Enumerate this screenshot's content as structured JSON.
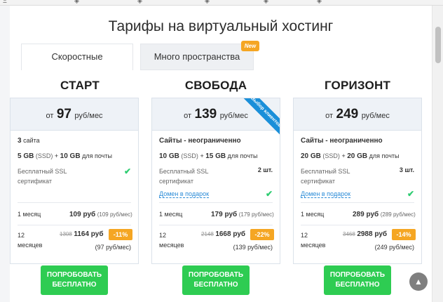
{
  "page": {
    "title": "Тарифы на виртуальный хостинг",
    "tabs": [
      {
        "label": "Скоростные"
      },
      {
        "label": "Много пространства"
      }
    ],
    "new_badge": "New",
    "ribbon": "Выбор клиентов",
    "button_line1": "ПОПРОБОВАТЬ",
    "button_line2": "БЕСПЛАТНО"
  },
  "plans": [
    {
      "name": "СТАРТ",
      "price_prefix": "от",
      "price": "97",
      "price_unit": "руб/мес",
      "sites": "3",
      "sites_label": "сайта",
      "disk": "5 GB",
      "disk_type": "(SSD)",
      "plus": "+",
      "mail": "10 GB",
      "mail_label": "для почты",
      "ssl_label": "Бесплатный SSL сертификат",
      "month_label": "1 месяц",
      "month_price": "109 руб",
      "month_per": "(109 руб/мес)",
      "year_label": "12 месяцев",
      "year_old": "1308",
      "year_price": "1164 руб",
      "year_discount": "-11%",
      "year_per": "(97 руб/мес)"
    },
    {
      "name": "СВОБОДА",
      "price_prefix": "от",
      "price": "139",
      "price_unit": "руб/мес",
      "sites": "Сайты - неограниченно",
      "disk": "10 GB",
      "disk_type": "(SSD)",
      "plus": "+",
      "mail": "15 GB",
      "mail_label": "для почты",
      "ssl_label": "Бесплатный SSL сертификат",
      "ssl_count": "2 шт.",
      "domain_label": "Домен в подарок",
      "month_label": "1 месяц",
      "month_price": "179 руб",
      "month_per": "(179 руб/мес)",
      "year_label": "12 месяцев",
      "year_old": "2148",
      "year_price": "1668 руб",
      "year_discount": "-22%",
      "year_per": "(139 руб/мес)"
    },
    {
      "name": "ГОРИЗОНТ",
      "price_prefix": "от",
      "price": "249",
      "price_unit": "руб/мес",
      "sites": "Сайты - неограниченно",
      "disk": "20 GB",
      "disk_type": "(SSD)",
      "plus": "+",
      "mail": "20 GB",
      "mail_label": "для почты",
      "ssl_label": "Бесплатный SSL сертификат",
      "ssl_count": "3 шт.",
      "domain_label": "Домен в подарок",
      "month_label": "1 месяц",
      "month_price": "289 руб",
      "month_per": "(289 руб/мес)",
      "year_label": "12 месяцев",
      "year_old": "3468",
      "year_price": "2988 руб",
      "year_discount": "-14%",
      "year_per": "(249 руб/мес)"
    }
  ],
  "colors": {
    "accent_green": "#2ecc52",
    "discount_orange": "#f5a623",
    "ribbon_blue": "#1a8fd9",
    "link_blue": "#2a8bd7"
  },
  "icons": {
    "check": "check-icon",
    "scroll_top": "arrow-up-icon"
  }
}
